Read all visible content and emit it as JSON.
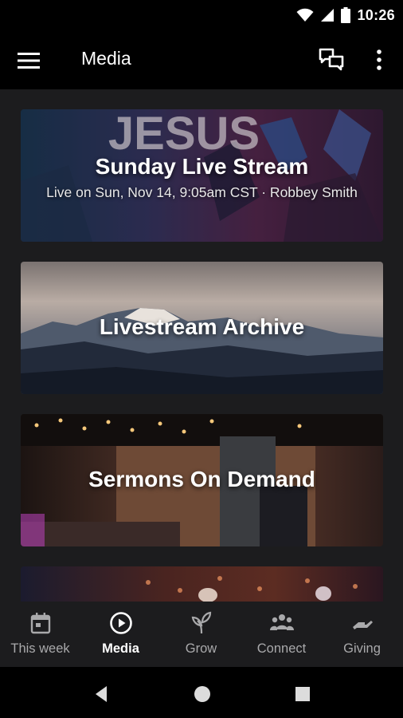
{
  "status_bar": {
    "time": "10:26",
    "icons": [
      "wifi-icon",
      "signal-icon",
      "battery-icon"
    ]
  },
  "app_bar": {
    "title": "Media",
    "menu_icon": "hamburger-menu-icon",
    "chat_icon": "chat-icon",
    "more_icon": "more-vert-icon"
  },
  "cards": [
    {
      "title": "Sunday Live Stream",
      "subtitle": "Live on Sun, Nov 14, 9:05am CST · Robbey Smith",
      "background_text": "JESUS"
    },
    {
      "title": "Livestream Archive"
    },
    {
      "title": "Sermons On Demand"
    },
    {
      "title": ""
    }
  ],
  "bottom_nav": {
    "items": [
      {
        "label": "This week",
        "icon": "calendar-icon",
        "active": false
      },
      {
        "label": "Media",
        "icon": "play-circle-icon",
        "active": true
      },
      {
        "label": "Grow",
        "icon": "sprout-icon",
        "active": false
      },
      {
        "label": "Connect",
        "icon": "people-icon",
        "active": false
      },
      {
        "label": "Giving",
        "icon": "hand-giving-icon",
        "active": false
      }
    ]
  },
  "system_nav": {
    "icons": [
      "back-icon",
      "home-icon",
      "recents-icon"
    ]
  },
  "colors": {
    "bar_background": "#000000",
    "content_background": "#1c1c1e",
    "active_nav": "#ffffff",
    "inactive_nav": "#a9a9ab"
  }
}
